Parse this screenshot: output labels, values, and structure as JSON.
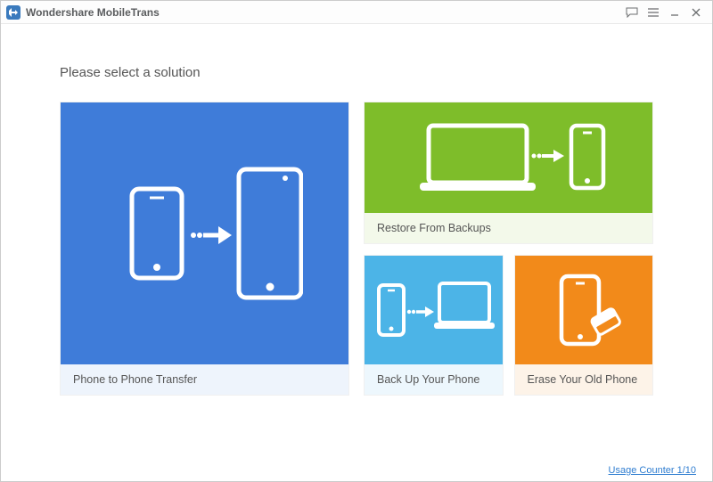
{
  "app": {
    "title": "Wondershare MobileTrans"
  },
  "heading": "Please select a solution",
  "cards": {
    "phone_to_phone": "Phone to Phone Transfer",
    "restore": "Restore From Backups",
    "backup": "Back Up Your Phone",
    "erase": "Erase Your Old Phone"
  },
  "footer": {
    "usage_counter": "Usage Counter 1/10"
  },
  "colors": {
    "blue": "#3f7cd9",
    "green": "#7ebd2a",
    "cyan": "#4cb4e7",
    "orange": "#f28a1a"
  }
}
